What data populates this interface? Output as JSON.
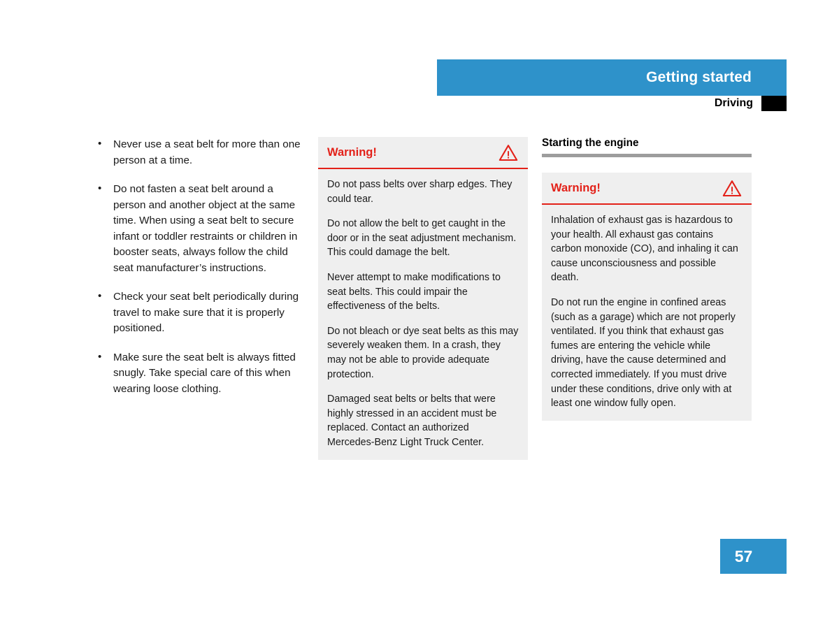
{
  "header": {
    "title": "Getting started",
    "subtitle": "Driving",
    "bar_color": "#2e92ca",
    "tab_color": "#000000"
  },
  "left_column": {
    "bullets": [
      "Never use a seat belt for more than one person at a time.",
      "Do not fasten a seat belt around a person and another object at the same time. When using a seat belt to secure infant or toddler restraints or children in booster seats, always follow the child seat manufacturer’s instructions.",
      "Check your seat belt periodically during travel to make sure that it is properly positioned.",
      "Make sure the seat belt is always fitted snugly. Take special care of this when wearing loose clothing."
    ]
  },
  "middle_column": {
    "warning": {
      "label": "Warning!",
      "icon": "warning-triangle-icon",
      "accent_color": "#e32119",
      "background_color": "#efefef",
      "paragraphs": [
        "Do not pass belts over sharp edges. They could tear.",
        "Do not allow the belt to get caught in the door or in the seat adjustment mechanism. This could damage the belt.",
        "Never attempt to make modifications to seat belts. This could impair the effectiveness of the belts.",
        "Do not bleach or dye seat belts as this may severely weaken them. In a crash, they may not be able to provide adequate protection.",
        "Damaged seat belts or belts that were highly stressed in an accident must be replaced. Contact an authorized Mercedes-Benz Light Truck Center."
      ]
    }
  },
  "right_column": {
    "section_title": "Starting the engine",
    "rule_color": "#9d9d9d",
    "warning": {
      "label": "Warning!",
      "icon": "warning-triangle-icon",
      "accent_color": "#e32119",
      "background_color": "#efefef",
      "paragraphs": [
        "Inhalation of exhaust gas is hazardous to your health. All exhaust gas contains carbon monoxide (CO), and inhaling it can cause unconsciousness and possible death.",
        "Do not run the engine in confined areas (such as a garage) which are not properly ventilated. If you think that exhaust gas fumes are entering the vehicle while driving, have the cause determined and corrected immediately. If you must drive under these conditions, drive only with at least one window fully open."
      ]
    }
  },
  "footer": {
    "page_number": "57",
    "badge_color": "#2e92ca"
  }
}
